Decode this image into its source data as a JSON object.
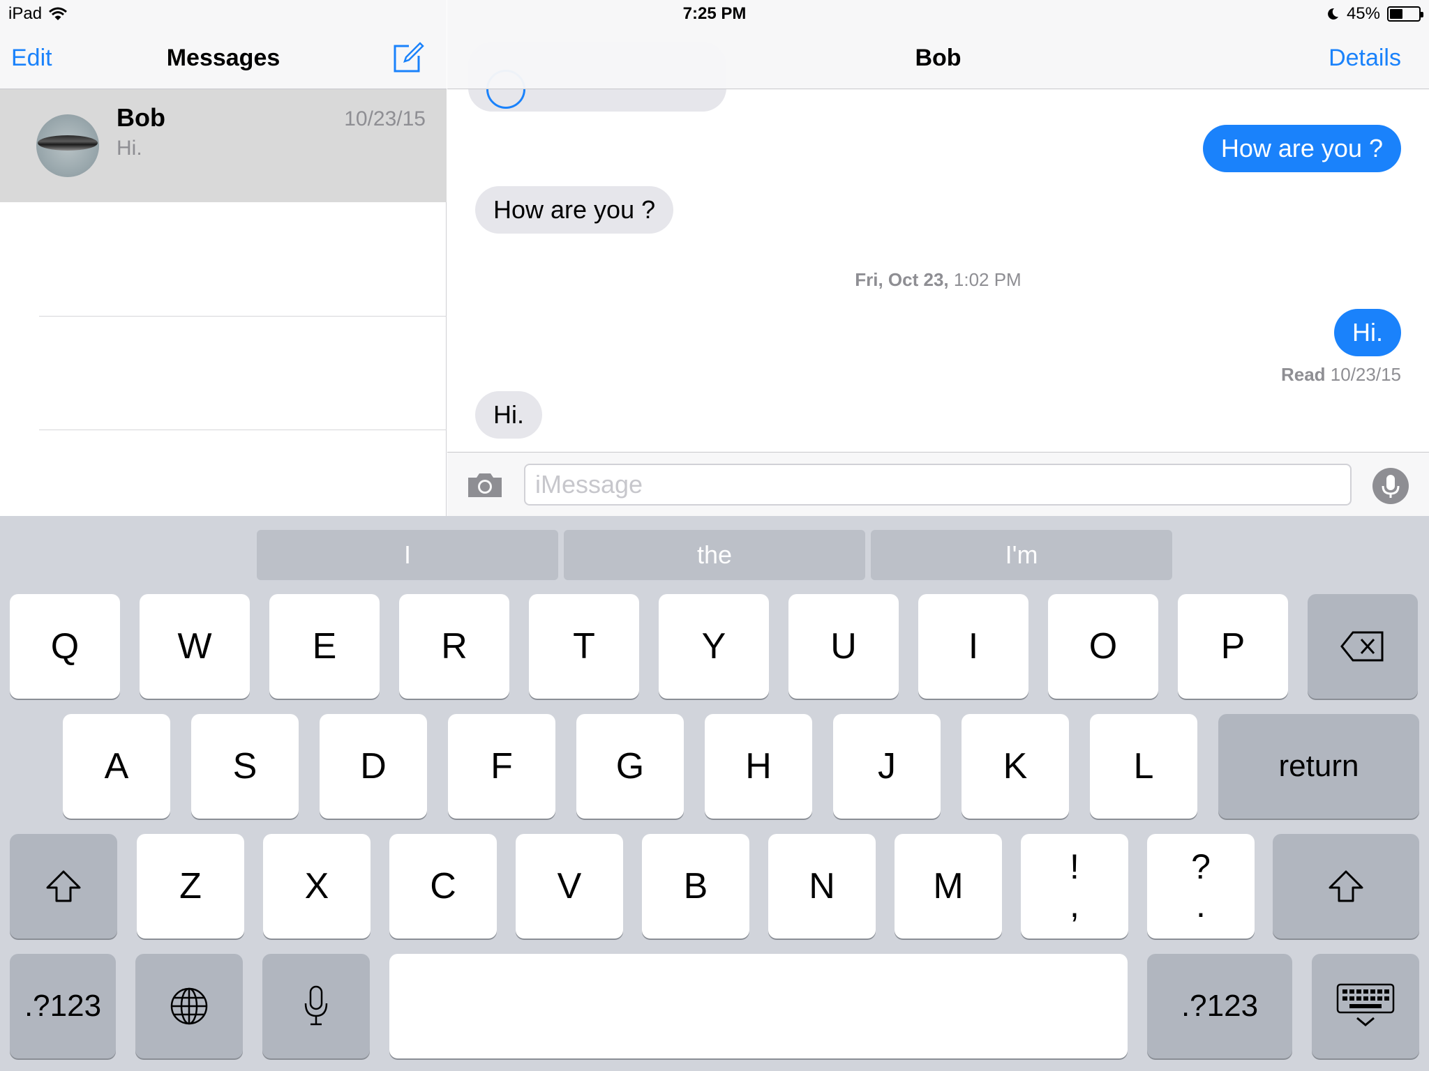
{
  "status_bar": {
    "device": "iPad",
    "time": "7:25 PM",
    "battery": "45%",
    "battery_level": 0.45
  },
  "sidebar": {
    "edit": "Edit",
    "title": "Messages",
    "conversations": [
      {
        "name": "Bob",
        "date": "10/23/15",
        "preview": "Hi."
      }
    ]
  },
  "chat": {
    "title": "Bob",
    "details": "Details",
    "messages": [
      {
        "text": "How are you ?",
        "dir": "out"
      },
      {
        "text": "How are you ?",
        "dir": "in"
      },
      {
        "text": "Hi.",
        "dir": "out"
      },
      {
        "text": "Hi.",
        "dir": "in"
      }
    ],
    "timestamp_day": "Fri, Oct 23,",
    "timestamp_time": "1:02 PM",
    "read_label": "Read",
    "read_date": "10/23/15",
    "input_placeholder": "iMessage",
    "input_value": ""
  },
  "keyboard": {
    "suggestions": [
      "I",
      "the",
      "I'm"
    ],
    "row1": [
      "Q",
      "W",
      "E",
      "R",
      "T",
      "Y",
      "U",
      "I",
      "O",
      "P"
    ],
    "row2": [
      "A",
      "S",
      "D",
      "F",
      "G",
      "H",
      "J",
      "K",
      "L"
    ],
    "row3": [
      "Z",
      "X",
      "C",
      "V",
      "B",
      "N",
      "M"
    ],
    "punct1": [
      "!",
      ","
    ],
    "punct2": [
      "?",
      "."
    ],
    "return": "return",
    "numbers": ".?123",
    "icons": {
      "backspace": "backspace-icon",
      "shift": "shift-icon",
      "globe": "globe-icon",
      "mic": "microphone-icon",
      "dismiss": "keyboard-dismiss-icon"
    }
  },
  "colors": {
    "accent": "#1a82fb",
    "incoming": "#e6e6eb",
    "keyboard_bg": "#d1d4db"
  }
}
